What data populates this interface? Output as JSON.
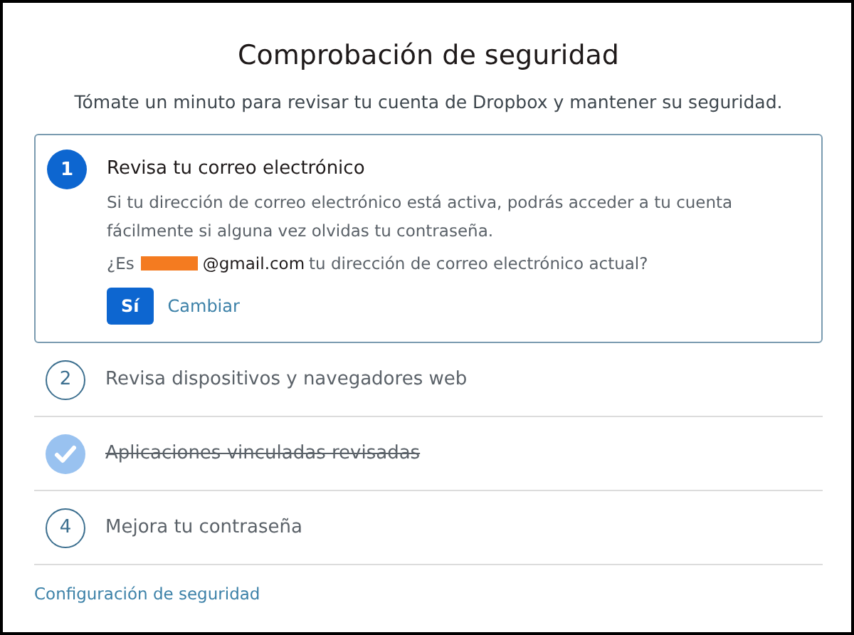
{
  "title": "Comprobación de seguridad",
  "subtitle": "Tómate un minuto para revisar tu cuenta de Dropbox y mantener su seguridad.",
  "steps": [
    {
      "number": "1",
      "label": "Revisa tu correo electrónico",
      "kind": "active",
      "description": "Si tu dirección de correo electrónico está activa, podrás acceder a tu cuenta fácilmente si alguna vez olvidas tu contraseña.",
      "question_prefix": "¿Es",
      "email": "@gmail.com",
      "question_suffix": "tu dirección de correo electrónico actual?",
      "confirm_button": "Sí",
      "change_link": "Cambiar"
    },
    {
      "number": "2",
      "label": "Revisa dispositivos y navegadores web",
      "kind": "pending"
    },
    {
      "label": "Aplicaciones vinculadas revisadas",
      "kind": "done"
    },
    {
      "number": "4",
      "label": "Mejora tu contraseña",
      "kind": "pending"
    }
  ],
  "footer_link": "Configuración de seguridad"
}
